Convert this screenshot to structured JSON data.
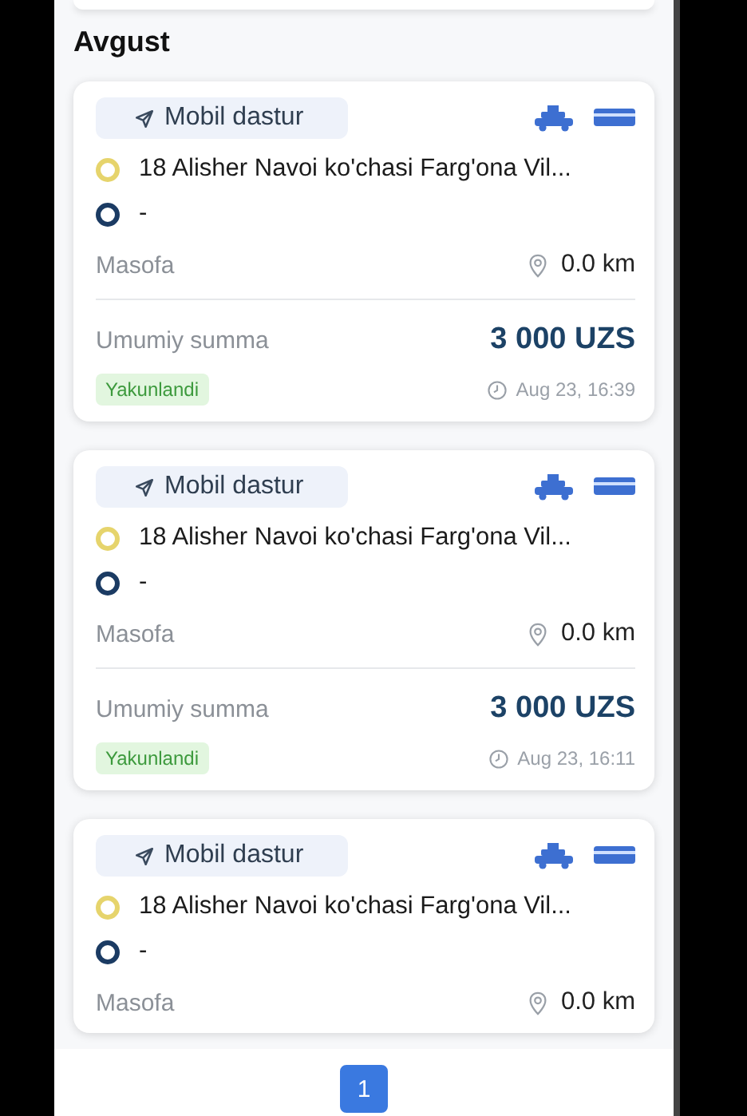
{
  "month_heading": "Avgust",
  "orders": [
    {
      "source": "Mobil dastur",
      "from": "18 Alisher Navoi ko'chasi Farg'ona Vil...",
      "to": "-",
      "distance_label": "Masofa",
      "distance": "0.0 km",
      "total_label": "Umumiy summa",
      "total": "3 000 UZS",
      "status": "Yakunlandi",
      "time": "Aug 23, 16:39"
    },
    {
      "source": "Mobil dastur",
      "from": "18 Alisher Navoi ko'chasi Farg'ona Vil...",
      "to": "-",
      "distance_label": "Masofa",
      "distance": "0.0 km",
      "total_label": "Umumiy summa",
      "total": "3 000 UZS",
      "status": "Yakunlandi",
      "time": "Aug 23, 16:11"
    },
    {
      "source": "Mobil dastur",
      "from": "18 Alisher Navoi ko'chasi Farg'ona Vil...",
      "to": "-",
      "distance_label": "Masofa",
      "distance": "0.0 km"
    }
  ],
  "pagination": [
    {
      "label": "1",
      "selected": true
    }
  ]
}
